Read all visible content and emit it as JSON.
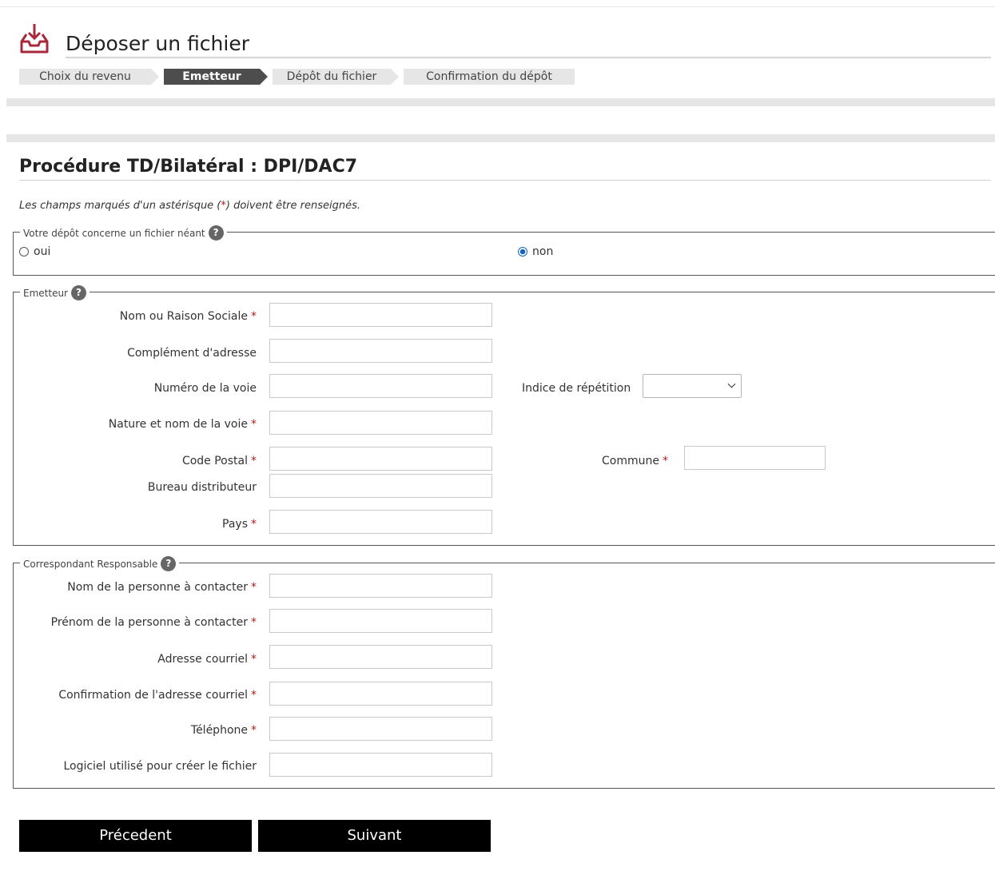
{
  "header": {
    "title": "Déposer un fichier",
    "icon": "inbox-download-icon",
    "accent_color": "#a8283c"
  },
  "steps": [
    {
      "label": "Choix du revenu",
      "active": false
    },
    {
      "label": "Emetteur",
      "active": true
    },
    {
      "label": "Dépôt du fichier",
      "active": false
    },
    {
      "label": "Confirmation du dépôt",
      "active": false
    }
  ],
  "section": {
    "title": "Procédure TD/Bilatéral : DPI/DAC7",
    "notice_before": "Les champs marqués d'un astérisque (",
    "notice_star": "*",
    "notice_after": ") doivent être renseignés."
  },
  "neant": {
    "legend": "Votre dépôt concerne un fichier néant",
    "help": "?",
    "options": [
      {
        "label": "oui",
        "checked": false
      },
      {
        "label": "non",
        "checked": true
      }
    ]
  },
  "emetteur": {
    "legend": "Emetteur",
    "help": "?",
    "fields": {
      "nom": {
        "label": "Nom ou Raison Sociale",
        "required": true,
        "value": ""
      },
      "complement": {
        "label": "Complément d'adresse",
        "required": false,
        "value": ""
      },
      "numero": {
        "label": "Numéro de la voie",
        "required": false,
        "value": ""
      },
      "indice": {
        "label": "Indice de répétition",
        "required": false,
        "value": ""
      },
      "nature": {
        "label": "Nature et nom de la voie",
        "required": true,
        "value": ""
      },
      "code_postal": {
        "label": "Code Postal",
        "required": true,
        "value": ""
      },
      "commune": {
        "label": "Commune",
        "required": true,
        "value": ""
      },
      "bureau": {
        "label": "Bureau distributeur",
        "required": false,
        "value": ""
      },
      "pays": {
        "label": "Pays",
        "required": true,
        "value": ""
      }
    }
  },
  "correspondant": {
    "legend": "Correspondant Responsable",
    "help": "?",
    "fields": {
      "nom": {
        "label": "Nom de la personne à contacter",
        "required": true,
        "value": ""
      },
      "prenom": {
        "label": "Prénom de la personne à contacter",
        "required": true,
        "value": ""
      },
      "email": {
        "label": "Adresse courriel",
        "required": true,
        "value": ""
      },
      "email_confirm": {
        "label": "Confirmation de l'adresse courriel",
        "required": true,
        "value": ""
      },
      "telephone": {
        "label": "Téléphone",
        "required": true,
        "value": ""
      },
      "logiciel": {
        "label": "Logiciel utilisé pour créer le fichier",
        "required": false,
        "value": ""
      }
    }
  },
  "required_mark": "*",
  "buttons": {
    "previous": "Précedent",
    "next": "Suivant"
  }
}
